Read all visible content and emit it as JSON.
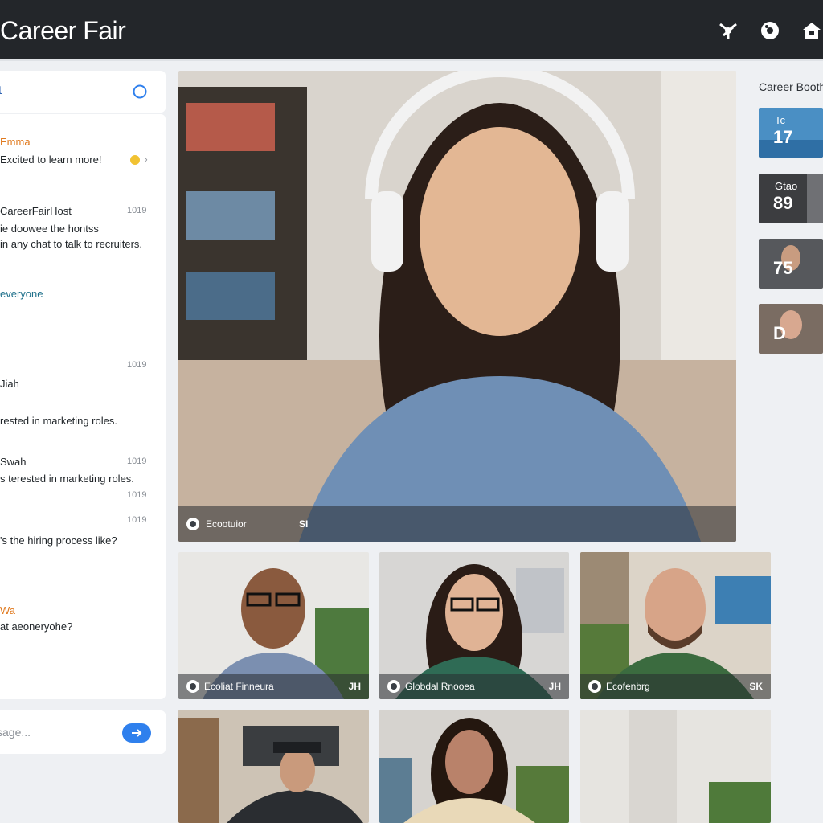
{
  "app": {
    "title": "Career Fair"
  },
  "topbar": {
    "icons": [
      "settings-icon",
      "gear-icon",
      "home-icon"
    ]
  },
  "chat": {
    "header_label": "t",
    "messages": [
      {
        "sender": "Emma",
        "text": "Excited to learn more!",
        "time": ""
      },
      {
        "sender": "CareerFairHost",
        "text_1": "ie doowee the hontss",
        "text_2": "in any chat to talk to recruiters.",
        "time": "1019"
      },
      {
        "mention": "everyone"
      },
      {
        "sender": "Jiah",
        "text": "rested in marketing roles.",
        "time": "1019"
      },
      {
        "sender": "Swah",
        "text": "s terested in marketing roles.",
        "time": "1019",
        "time_2": "1019"
      },
      {
        "text": "'s the hiring process like?",
        "time": "1019"
      },
      {
        "sender": "Wa",
        "text": "at aeoneryohe?"
      }
    ],
    "input_placeholder": "sage..."
  },
  "main_video": {
    "name": "Ecootuior",
    "tag": "SI"
  },
  "video_tiles": [
    {
      "name": "Ecoliat Finneura",
      "tag": "JH"
    },
    {
      "name": "Globdal Rnooea",
      "tag": "JH"
    },
    {
      "name": "Ecofenbrg",
      "tag": "SK"
    }
  ],
  "booths": {
    "title": "Career Booths",
    "items": [
      {
        "name": "Tc",
        "number": "17",
        "color": "#4a8fc4"
      },
      {
        "name": "Gtao",
        "number": "89",
        "color": "#3c3d40"
      },
      {
        "name": "",
        "number": "75",
        "color": "#56585c"
      },
      {
        "name": "",
        "number": "D",
        "color": "#7a6c62"
      }
    ]
  }
}
